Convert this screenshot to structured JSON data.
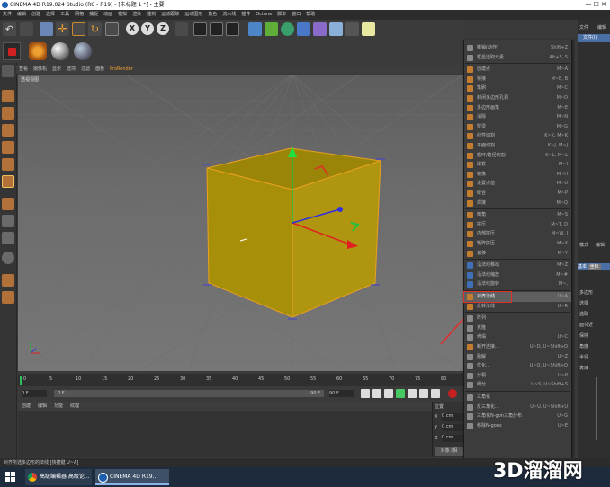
{
  "window": {
    "title": "CINEMA 4D R19.024 Studio (RC - R19) - [未标题 1 *] - 主要"
  },
  "menubar": [
    "文件",
    "编辑",
    "创建",
    "选择",
    "工具",
    "网格",
    "捕捉",
    "动画",
    "模拟",
    "渲染",
    "雕刻",
    "运动跟踪",
    "运动图形",
    "角色",
    "流水线",
    "插件",
    "Octane",
    "脚本",
    "窗口",
    "帮助"
  ],
  "toolbar": {
    "axes": [
      "X",
      "Y",
      "Z"
    ]
  },
  "viewport": {
    "menu": [
      "查看",
      "摄像机",
      "显示",
      "选项",
      "过滤",
      "面板",
      "ProRender"
    ],
    "label": "透视视图"
  },
  "timeline": {
    "ticks": [
      "0",
      "5",
      "10",
      "15",
      "20",
      "25",
      "30",
      "35",
      "40",
      "45",
      "50",
      "55",
      "60",
      "65",
      "70",
      "75",
      "80"
    ],
    "start_frame": "0 F",
    "current_frame": "0 F",
    "end_field": "90 F",
    "end_frame": "90 F"
  },
  "materials": {
    "menu": [
      "创建",
      "编辑",
      "功能",
      "纹理"
    ]
  },
  "coords": {
    "header": "位置",
    "rows": [
      {
        "axis": "X",
        "value": "0 cm"
      },
      {
        "axis": "Y",
        "value": "0 cm"
      },
      {
        "axis": "Z",
        "value": "0 cm"
      }
    ],
    "apply": "对象 (相"
  },
  "right_panel": {
    "tabs_top": [
      "文件",
      "编辑"
    ],
    "item": "文件(I)",
    "tabs_mid": [
      "模式",
      "编辑"
    ],
    "attr_tabs": [
      "基本",
      "坐标"
    ],
    "labels": [
      "多边形",
      "选择",
      "选取",
      "面邻近",
      "保持",
      "角度",
      "半径",
      "衰减"
    ]
  },
  "context_menu": {
    "items": [
      {
        "label": "撤销(动作)",
        "shortcut": "Shift+Z",
        "icon": "undo-icon",
        "color": "#8a8a8a"
      },
      {
        "label": "框显选取元素",
        "shortcut": "Alt+S, S",
        "icon": "frame-icon",
        "color": "#8a8a8a"
      },
      {
        "sep": true
      },
      {
        "label": "创建点",
        "shortcut": "M~A",
        "icon": "create-point-icon",
        "color": "#c47d2f"
      },
      {
        "label": "桥接",
        "shortcut": "M~B, B",
        "icon": "bridge-icon",
        "color": "#c47d2f"
      },
      {
        "label": "笔刷",
        "shortcut": "M~C",
        "icon": "brush-icon",
        "color": "#c47d2f"
      },
      {
        "label": "封闭多边形孔洞",
        "shortcut": "M~D",
        "icon": "close-hole-icon",
        "color": "#c47d2f"
      },
      {
        "label": "多边形画笔",
        "shortcut": "M~E",
        "icon": "polygon-pen-icon",
        "color": "#c47d2f"
      },
      {
        "label": "消除",
        "shortcut": "M~N",
        "icon": "dissolve-icon",
        "color": "#c47d2f"
      },
      {
        "label": "熨烫",
        "shortcut": "M~G",
        "icon": "iron-icon",
        "color": "#c47d2f"
      },
      {
        "label": "线性切割",
        "shortcut": "K~K, M~K",
        "icon": "line-cut-icon",
        "color": "#c47d2f"
      },
      {
        "label": "平面切割",
        "shortcut": "K~J, M~J",
        "icon": "plane-cut-icon",
        "color": "#c47d2f"
      },
      {
        "label": "循环/路径切割",
        "shortcut": "K~L, M~L",
        "icon": "loop-cut-icon",
        "color": "#c47d2f"
      },
      {
        "label": "磁铁",
        "shortcut": "M~I",
        "icon": "magnet-icon",
        "color": "#c47d2f"
      },
      {
        "label": "镜像",
        "shortcut": "M~H",
        "icon": "mirror-icon",
        "color": "#c47d2f"
      },
      {
        "label": "设置点值",
        "shortcut": "M~U",
        "icon": "set-point-icon",
        "color": "#c47d2f"
      },
      {
        "label": "缝合",
        "shortcut": "M~P",
        "icon": "stitch-icon",
        "color": "#c47d2f"
      },
      {
        "label": "焊接",
        "shortcut": "M~Q",
        "icon": "weld-icon",
        "color": "#c47d2f"
      },
      {
        "sep": true
      },
      {
        "label": "倒角",
        "shortcut": "M~S",
        "icon": "bevel-icon",
        "color": "#c47d2f"
      },
      {
        "label": "挤压",
        "shortcut": "M~T, D",
        "icon": "extrude-icon",
        "color": "#c47d2f"
      },
      {
        "label": "内部挤压",
        "shortcut": "M~W, I",
        "icon": "inner-extrude-icon",
        "color": "#c47d2f"
      },
      {
        "label": "矩阵挤压",
        "shortcut": "M~X",
        "icon": "matrix-extrude-icon",
        "color": "#c47d2f"
      },
      {
        "label": "偏移",
        "shortcut": "M~Y",
        "icon": "offset-icon",
        "color": "#c47d2f"
      },
      {
        "sep": true
      },
      {
        "label": "沿法线移动",
        "shortcut": "M~Z",
        "icon": "normal-move-icon",
        "color": "#3f6fb4"
      },
      {
        "label": "沿法线缩放",
        "shortcut": "M~#",
        "icon": "normal-scale-icon",
        "color": "#3f6fb4"
      },
      {
        "label": "沿法线旋转",
        "shortcut": "M~,",
        "icon": "normal-rotate-icon",
        "color": "#3f6fb4"
      },
      {
        "sep": true
      },
      {
        "label": "对齐法线",
        "shortcut": "U~A",
        "icon": "align-normals-icon",
        "color": "#c47d2f",
        "highlight": true
      },
      {
        "label": "反转法线",
        "shortcut": "U~R",
        "icon": "reverse-normals-icon",
        "color": "#c47d2f"
      },
      {
        "sep": true
      },
      {
        "label": "阵列",
        "shortcut": "",
        "icon": "array-icon",
        "color": "#8a8a8a"
      },
      {
        "label": "克隆",
        "shortcut": "",
        "icon": "clone-icon",
        "color": "#8a8a8a"
      },
      {
        "label": "坍塌",
        "shortcut": "U~C",
        "icon": "collapse-icon",
        "color": "#8a8a8a"
      },
      {
        "label": "断开连接...",
        "shortcut": "U~D, U~Shift+D",
        "icon": "disconnect-icon",
        "color": "#c47d2f"
      },
      {
        "label": "融解",
        "shortcut": "U~Z",
        "icon": "melt-icon",
        "color": "#8a8a8a"
      },
      {
        "label": "优化...",
        "shortcut": "U~O, U~Shift+O",
        "icon": "optimize-icon",
        "color": "#8a8a8a"
      },
      {
        "label": "分裂",
        "shortcut": "U~P",
        "icon": "split-icon",
        "color": "#8a8a8a"
      },
      {
        "label": "细分...",
        "shortcut": "U~S, U~Shift+S",
        "icon": "subdivide-icon",
        "color": "#8a8a8a"
      },
      {
        "sep": true
      },
      {
        "label": "三角化",
        "shortcut": "",
        "icon": "triangulate-icon",
        "color": "#8a8a8a"
      },
      {
        "label": "反三角化...",
        "shortcut": "U~U, U~Shift+U",
        "icon": "untriangulate-icon",
        "color": "#8a8a8a"
      },
      {
        "label": "三角化N-gon三角分布",
        "shortcut": "U~G",
        "icon": "ngon-icon",
        "color": "#8a8a8a"
      },
      {
        "label": "移除N-gons",
        "shortcut": "U~E",
        "icon": "remove-ngons-icon",
        "color": "#8a8a8a"
      }
    ]
  },
  "statusbar": {
    "text": "对齐所选多边形的法线 [快捷键 U~A]"
  },
  "taskbar": {
    "items": [
      {
        "label": "高级编辑器 高级论..."
      },
      {
        "label": "CINEMA 4D R19..."
      }
    ]
  },
  "watermark": "3D溜溜网",
  "colors": {
    "cube_fill": "#a88f0a",
    "cube_edge": "#e8a020",
    "highlight": "#5f5f5f",
    "arrow": "#e0302a"
  }
}
